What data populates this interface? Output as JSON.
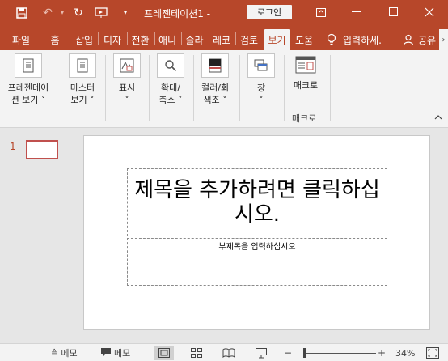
{
  "titlebar": {
    "doc_title": "프레젠테이션1  -",
    "login_label": "로그인"
  },
  "tabs": [
    {
      "label": "파일"
    },
    {
      "label": "홈"
    },
    {
      "label": "삽입"
    },
    {
      "label": "디자"
    },
    {
      "label": "전환"
    },
    {
      "label": "애니"
    },
    {
      "label": "슬라"
    },
    {
      "label": "레코"
    },
    {
      "label": "검토"
    },
    {
      "label": "보기"
    },
    {
      "label": "도움"
    }
  ],
  "tell_me": "입력하세.",
  "share_label": "공유",
  "ribbon": {
    "buttons": [
      {
        "line1": "프레젠테이",
        "line2": "션 보기 ˅"
      },
      {
        "line1": "마스터",
        "line2": "보기 ˅"
      },
      {
        "line1": "표시",
        "line2": "˅"
      },
      {
        "line1": "확대/",
        "line2": "축소 ˅"
      },
      {
        "line1": "컬러/회",
        "line2": "색조 ˅"
      },
      {
        "line1": "창",
        "line2": "˅"
      },
      {
        "line1": "매크로",
        "line2": ""
      }
    ],
    "group_macro": "매크로"
  },
  "slides_panel": {
    "slide_number": "1"
  },
  "slide": {
    "title_placeholder": "제목을 추가하려면 클릭하십시오.",
    "subtitle_placeholder": "부제목을 입력하십시오"
  },
  "statusbar": {
    "notes_label": "메모",
    "comments_label": "메모",
    "zoom_level": "34%",
    "zoom_minus": "−",
    "zoom_plus": "+"
  },
  "colors": {
    "accent": "#b7472a",
    "ribbon_bg": "#f3f3f3",
    "workspace_bg": "#e6e6e6"
  }
}
